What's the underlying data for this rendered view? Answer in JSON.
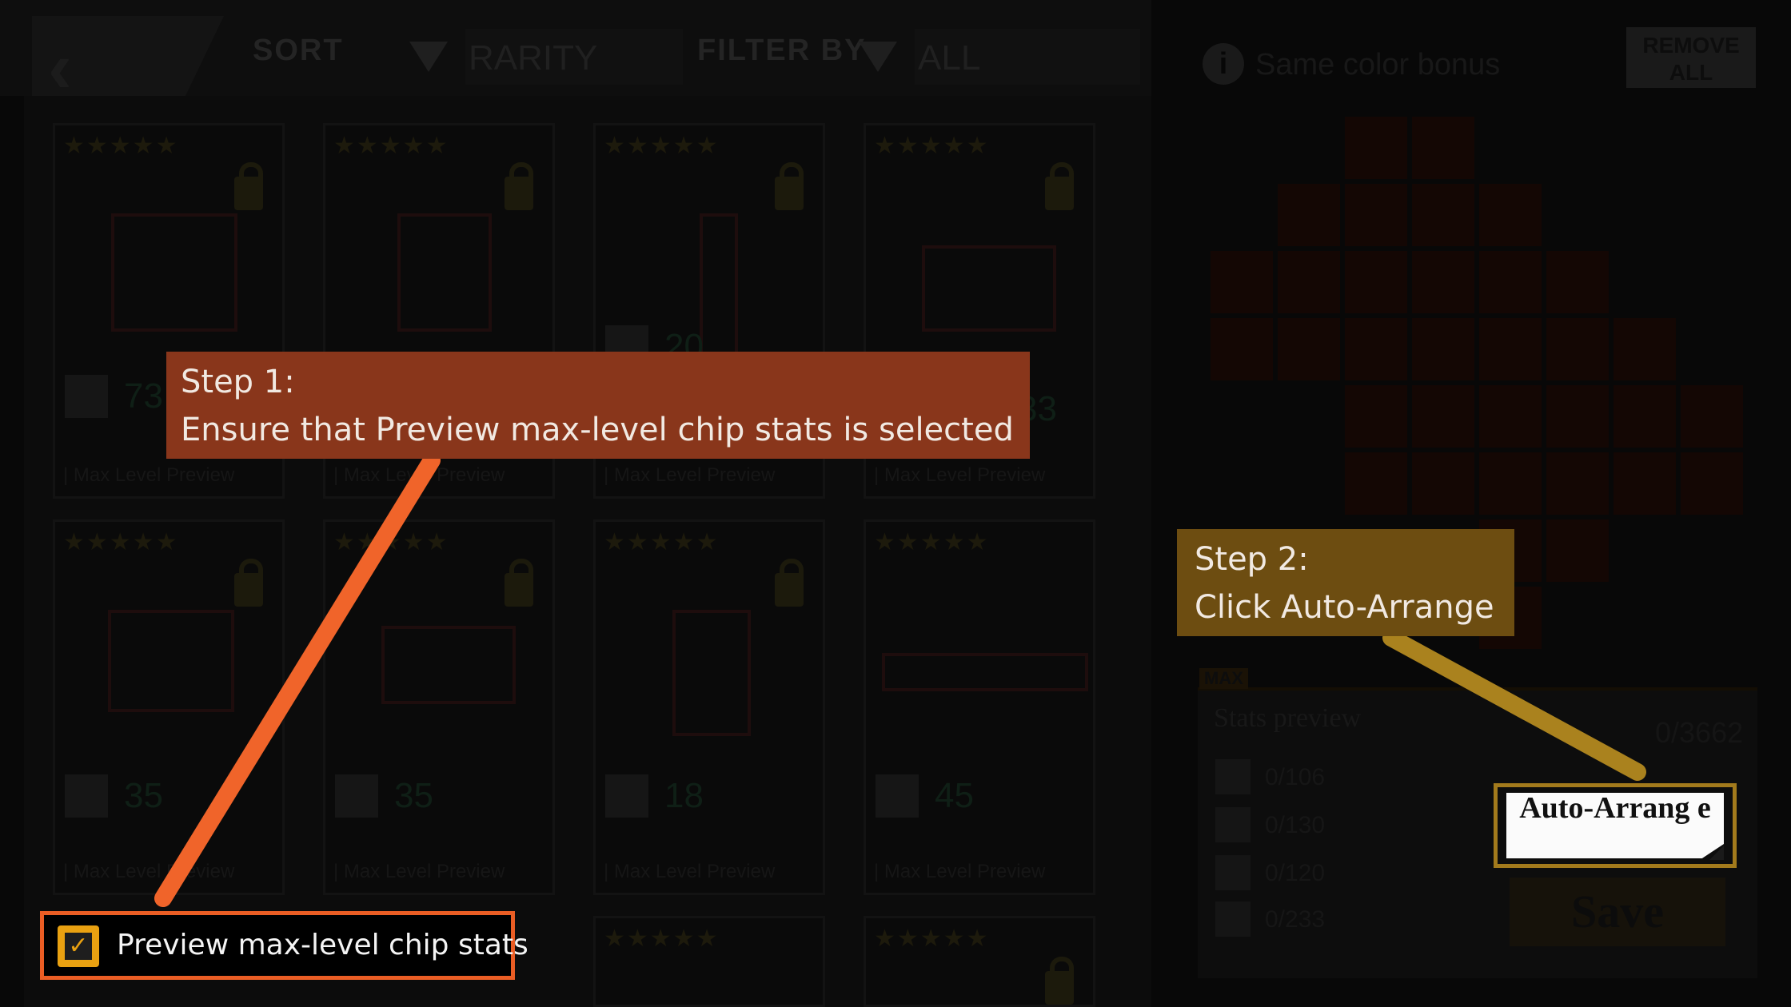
{
  "topbar": {
    "sort_label": "SORT",
    "sort_value": "RARITY",
    "filter_label": "FILTER BY",
    "filter_value": "ALL"
  },
  "chips": [
    {
      "stars": "★★★★★",
      "footer": "| Max Level Preview",
      "stat1": "73"
    },
    {
      "stars": "★★★★★",
      "footer": "| Max Level Preview",
      "stat1": ""
    },
    {
      "stars": "★★★★★",
      "footer": "| Max Level Preview",
      "stat1": "20"
    },
    {
      "stars": "★★★★★",
      "footer": "| Max Level Preview",
      "stat1": "33"
    },
    {
      "stars": "★★★★★",
      "footer": "| Max Level Preview",
      "stat1": "35"
    },
    {
      "stars": "★★★★★",
      "footer": "| Max Level Preview",
      "stat1": "35"
    },
    {
      "stars": "★★★★★",
      "footer": "| Max Level Preview",
      "stat1": "18"
    },
    {
      "stars": "★★★★★",
      "footer": "| Max Level Preview",
      "stat1": "45"
    },
    {
      "stars": "★★★★★"
    },
    {
      "stars": "★★★★★"
    }
  ],
  "right_panel": {
    "same_color_bonus": "Same color bonus",
    "remove_all": "REMOVE ALL",
    "max_tag": "MAX",
    "stats_title": "Stats preview",
    "stats_total": "0/3662",
    "stats": [
      "0/106",
      "0/130",
      "0/120",
      "0/233"
    ],
    "save_label": "Save",
    "auto_arrange_label": "Auto-Arrang e"
  },
  "annotations": {
    "step1_title": "Step 1:",
    "step1_text": "Ensure that Preview max-level chip stats is selected",
    "step2_title": "Step 2:",
    "step2_text": "Click Auto-Arrange",
    "preview_label": "Preview max-level chip stats",
    "preview_checked": true,
    "step1_color": "#89361b",
    "step2_color": "#6d4d11",
    "highlight_orange": "#ea5d24",
    "highlight_gold": "#a27a1c"
  }
}
